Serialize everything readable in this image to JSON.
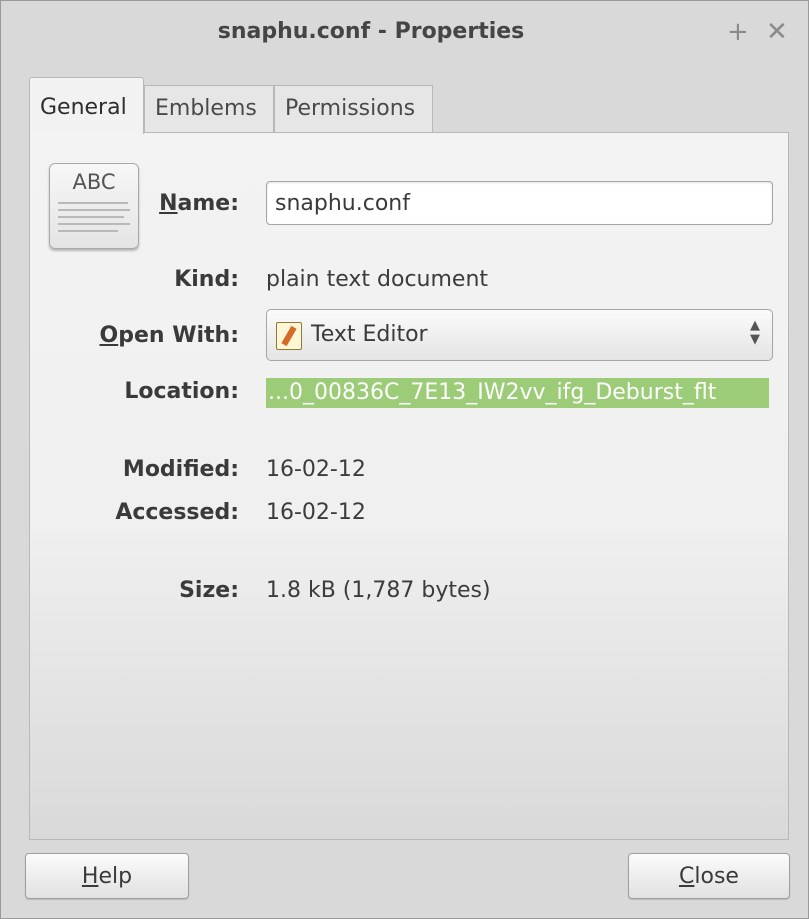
{
  "window": {
    "title": "snaphu.conf - Properties",
    "pin_glyph": "+",
    "close_glyph": "✕"
  },
  "tabs": [
    {
      "label": "General",
      "active": true
    },
    {
      "label": "Emblems",
      "active": false
    },
    {
      "label": "Permissions",
      "active": false
    }
  ],
  "file_icon": {
    "text": "ABC",
    "icon": "text-document-icon"
  },
  "fields": {
    "name_label_underlined": "N",
    "name_label_rest": "ame:",
    "name_value": "snaphu.conf",
    "kind_label": "Kind:",
    "kind_value": "plain text document",
    "open_with_label_underlined": "O",
    "open_with_label_rest": "pen With:",
    "open_with_value": "Text Editor",
    "open_with_icon": "text-editor-icon",
    "location_label": "Location:",
    "location_value": "...0_00836C_7E13_IW2vv_ifg_Deburst_flt",
    "modified_label": "Modified:",
    "modified_value": "16-02-12",
    "accessed_label": "Accessed:",
    "accessed_value": "16-02-12",
    "size_label": "Size:",
    "size_value": "1.8 kB (1,787 bytes)"
  },
  "buttons": {
    "help_underlined": "H",
    "help_rest": "elp",
    "close_underlined": "C",
    "close_rest": "lose"
  },
  "colors": {
    "selection": "#9ccc78",
    "window_bg": "#d9d9d9"
  }
}
